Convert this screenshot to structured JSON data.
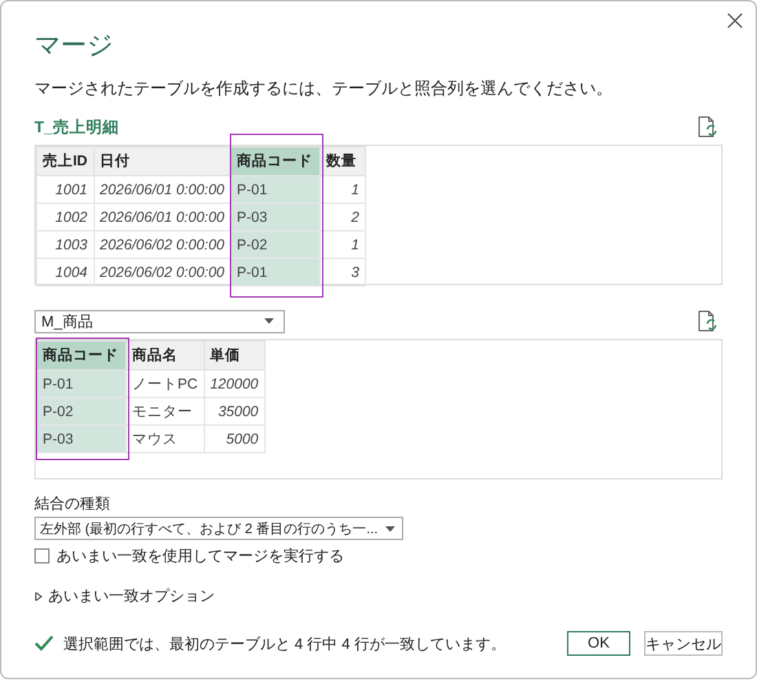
{
  "dialog": {
    "title": "マージ",
    "description": "マージされたテーブルを作成するには、テーブルと照合列を選んでください。"
  },
  "tables": [
    {
      "name": "T_売上明細",
      "kind": "label",
      "columns": [
        {
          "header": "売上ID",
          "kind": "number",
          "selected": false
        },
        {
          "header": "日付",
          "kind": "date",
          "selected": false
        },
        {
          "header": "商品コード",
          "kind": "text",
          "selected": true
        },
        {
          "header": "数量",
          "kind": "number",
          "selected": false
        }
      ],
      "rows": [
        [
          "1001",
          "2026/06/01 0:00:00",
          "P-01",
          "1"
        ],
        [
          "1002",
          "2026/06/01 0:00:00",
          "P-03",
          "2"
        ],
        [
          "1003",
          "2026/06/02 0:00:00",
          "P-02",
          "1"
        ],
        [
          "1004",
          "2026/06/02 0:00:00",
          "P-01",
          "3"
        ]
      ]
    },
    {
      "name": "M_商品",
      "kind": "dropdown",
      "columns": [
        {
          "header": "商品コード",
          "kind": "text",
          "selected": true
        },
        {
          "header": "商品名",
          "kind": "text",
          "selected": false
        },
        {
          "header": "単価",
          "kind": "number",
          "selected": false
        }
      ],
      "rows": [
        [
          "P-01",
          "ノートPC",
          "120000"
        ],
        [
          "P-02",
          "モニター",
          "35000"
        ],
        [
          "P-03",
          "マウス",
          "5000"
        ]
      ]
    }
  ],
  "join_kind": {
    "label": "結合の種類",
    "value": "左外部 (最初の行すべて、および 2 番目の行のうち一..."
  },
  "fuzzy_match": {
    "label": "あいまい一致を使用してマージを実行する",
    "checked": false
  },
  "fuzzy_options": {
    "label": "あいまい一致オプション",
    "expanded": false
  },
  "status": {
    "text": "選択範囲では、最初のテーブルと 4 行中 4 行が一致しています。",
    "valid": true
  },
  "buttons": [
    {
      "label": "OK",
      "kind": "primary"
    },
    {
      "label": "キャンセル",
      "kind": "secondary"
    }
  ]
}
